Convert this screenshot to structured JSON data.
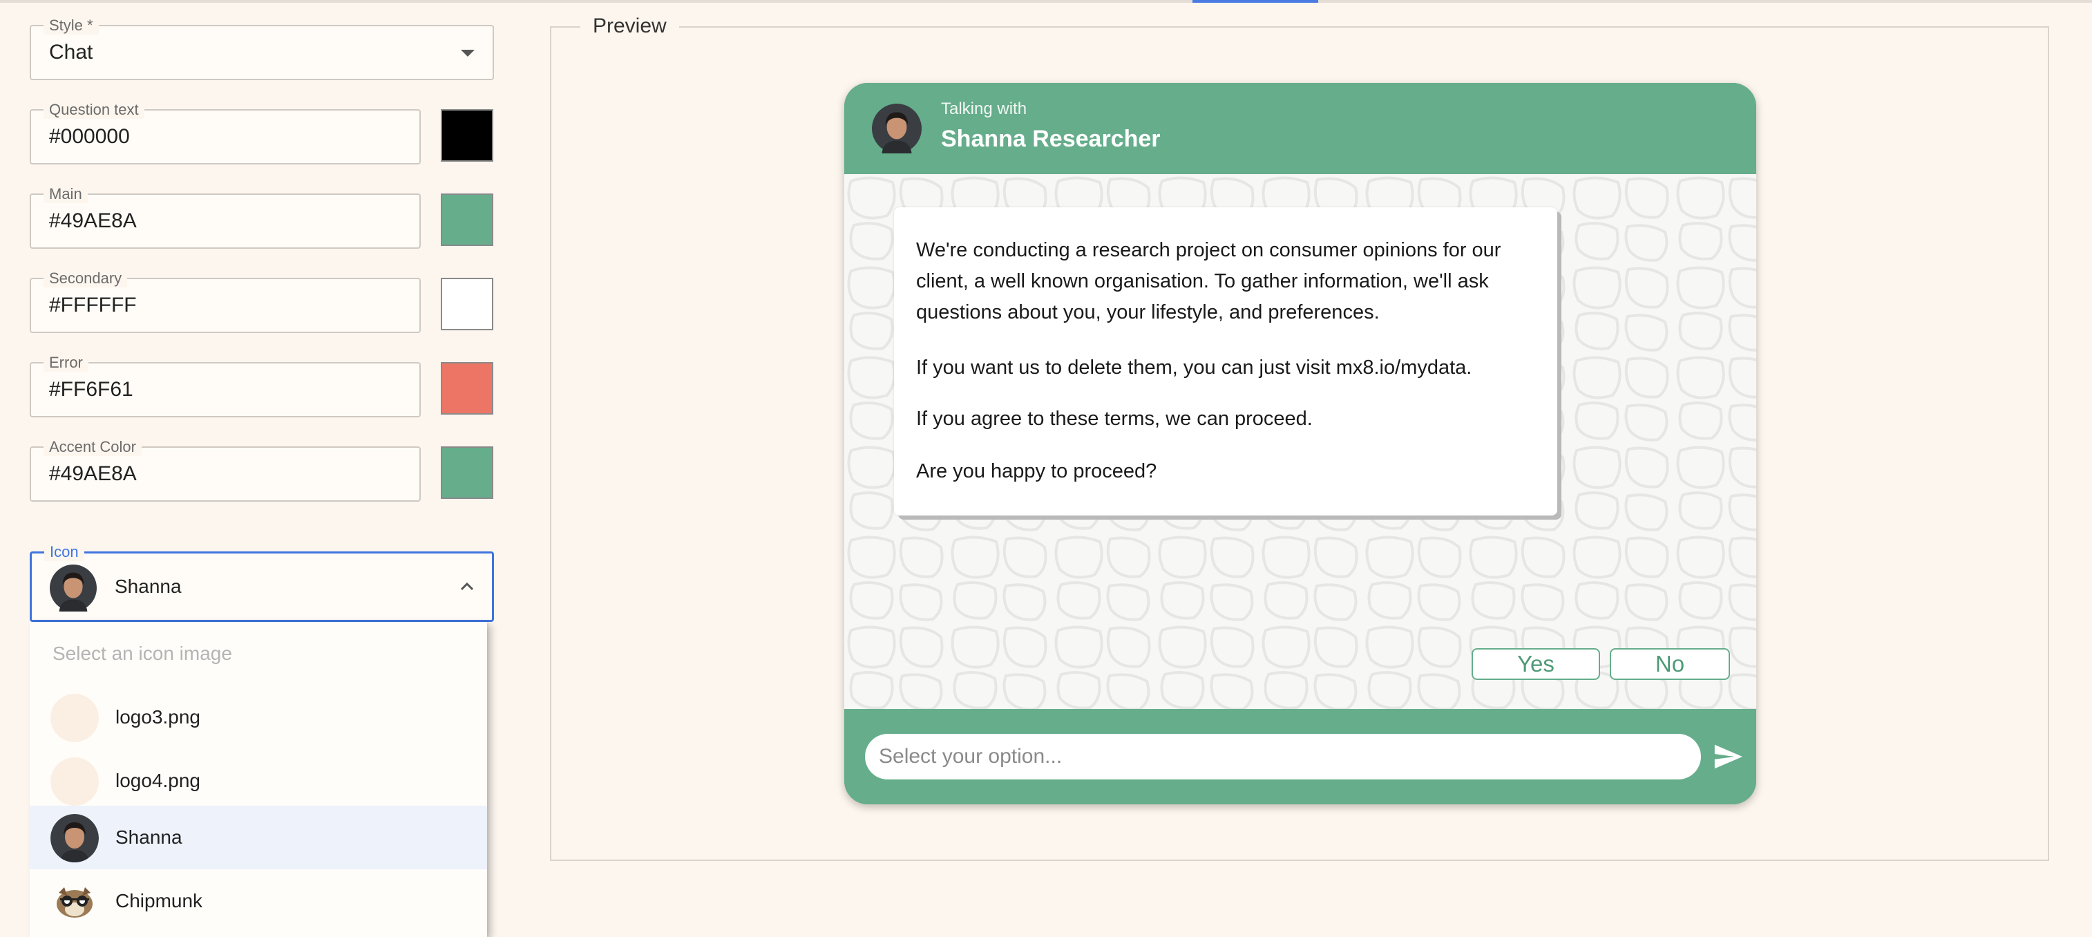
{
  "form": {
    "style": {
      "label": "Style *",
      "value": "Chat"
    },
    "colors": [
      {
        "label": "Question text",
        "value": "#000000",
        "swatch": "#000000"
      },
      {
        "label": "Main",
        "value": "#49AE8A",
        "swatch": "#65ad8b"
      },
      {
        "label": "Secondary",
        "value": "#FFFFFF",
        "swatch": "#ffffff"
      },
      {
        "label": "Error",
        "value": "#FF6F61",
        "swatch": "#ec7565"
      },
      {
        "label": "Accent Color",
        "value": "#49AE8A",
        "swatch": "#65ad8b"
      }
    ],
    "icon": {
      "label": "Icon",
      "value": "Shanna",
      "placeholder": "Select an icon image",
      "options": [
        {
          "label": "logo3.png",
          "icon": "blank-icon"
        },
        {
          "label": "logo4.png",
          "icon": "blank-icon"
        },
        {
          "label": "Shanna",
          "icon": "shanna-avatar-icon",
          "selected": true
        },
        {
          "label": "Chipmunk",
          "icon": "chipmunk-icon"
        }
      ]
    }
  },
  "preview": {
    "legend": "Preview",
    "chat": {
      "header_sub": "Talking with",
      "header_name": "Shanna Researcher",
      "message": [
        "We're conducting a research project on consumer opinions for our client, a well known organisation. To gather information, we'll ask questions about you, your lifestyle, and preferences.",
        "If you want us to delete them, you can just visit mx8.io/mydata.",
        "If you agree to these terms, we can proceed.",
        "Are you happy to proceed?"
      ],
      "buttons": [
        "Yes",
        "No"
      ],
      "input_placeholder": "Select your option..."
    }
  },
  "colors": {
    "main": "#65ad8b",
    "accent_focus": "#3f74df",
    "background": "#fdf6ee"
  }
}
